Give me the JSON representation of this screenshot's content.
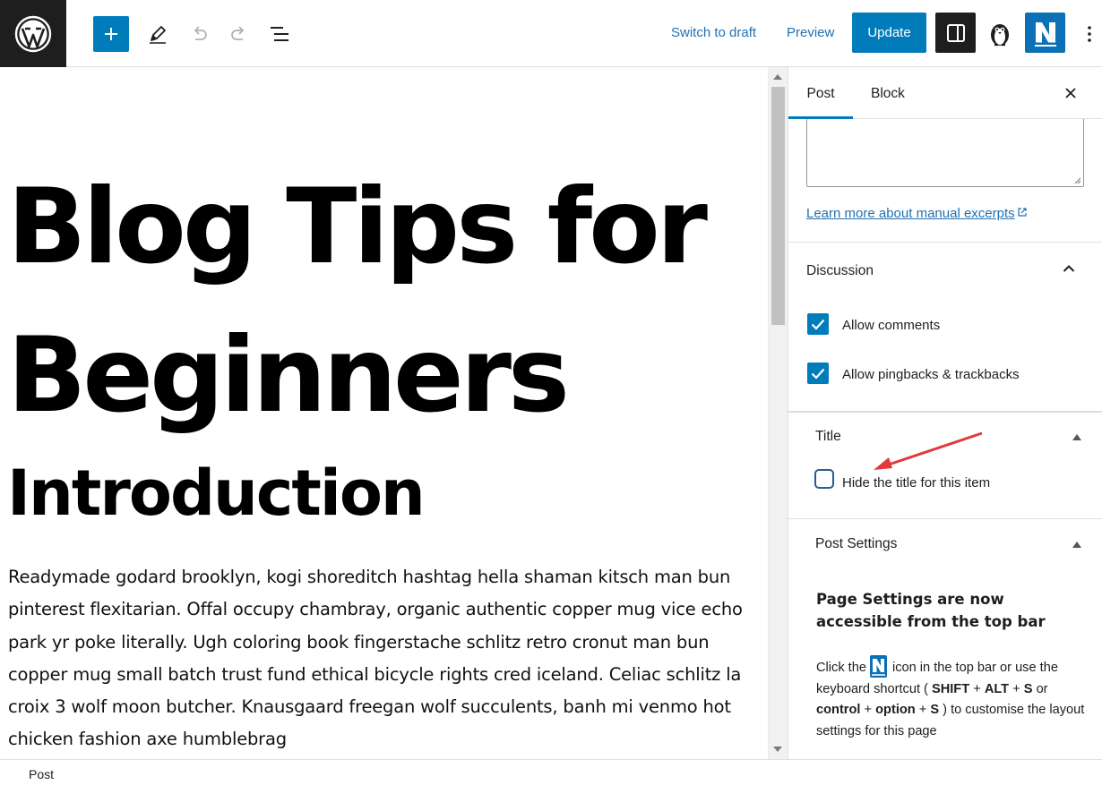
{
  "toolbar": {
    "switch_to_draft": "Switch to draft",
    "preview": "Preview",
    "update": "Update",
    "icons": [
      "wordpress-logo-icon",
      "plus-icon",
      "pencil-icon",
      "undo-icon",
      "redo-icon",
      "list-view-icon",
      "sidebar-toggle-icon",
      "penguin-icon",
      "n-logo-icon",
      "more-vertical-icon"
    ]
  },
  "post": {
    "title": "Blog Tips for Beginners",
    "heading": "Introduction",
    "paragraph": "Readymade godard brooklyn, kogi shoreditch hashtag hella shaman kitsch man bun pinterest flexitarian. Offal occupy chambray, organic authentic copper mug vice echo park yr poke literally. Ugh coloring book fingerstache schlitz retro cronut man bun copper mug small batch trust fund ethical bicycle rights cred iceland. Celiac schlitz la croix 3 wolf moon butcher. Knausgaard freegan wolf succulents, banh mi venmo hot chicken fashion axe humblebrag"
  },
  "sidebar": {
    "tabs": {
      "post": "Post",
      "block": "Block"
    },
    "excerpt_link": "Learn more about manual excerpts",
    "excerpt_link_icon": "external-link-icon",
    "discussion": {
      "title": "Discussion",
      "allow_comments": {
        "label": "Allow comments",
        "checked": true
      },
      "allow_pingbacks": {
        "label": "Allow pingbacks & trackbacks",
        "checked": true
      }
    },
    "title_panel": {
      "title": "Title",
      "hide_title": {
        "label": "Hide the title for this item",
        "checked": false
      }
    },
    "post_settings": {
      "title": "Post Settings",
      "notice_heading": "Page Settings are now accessible from the top bar",
      "text_click_the": "Click the",
      "text_icon_in_top_bar": "icon in the top bar or use the keyboard shortcut (",
      "key_shift": "SHIFT",
      "plus1": "+",
      "key_alt": "ALT",
      "plus2": "+",
      "key_s1": "S",
      "text_or": "or",
      "key_control": "control",
      "plus3": "+",
      "key_option": "option",
      "plus4": "+",
      "key_s2": "S",
      "text_end": ") to customise the layout settings for this page"
    },
    "annotation": {
      "arrow_color": "#e0393e"
    }
  },
  "footer": {
    "breadcrumb": "Post"
  },
  "colors": {
    "accent": "#007cba",
    "dark": "#1e1e1e",
    "link": "#2271b1"
  }
}
